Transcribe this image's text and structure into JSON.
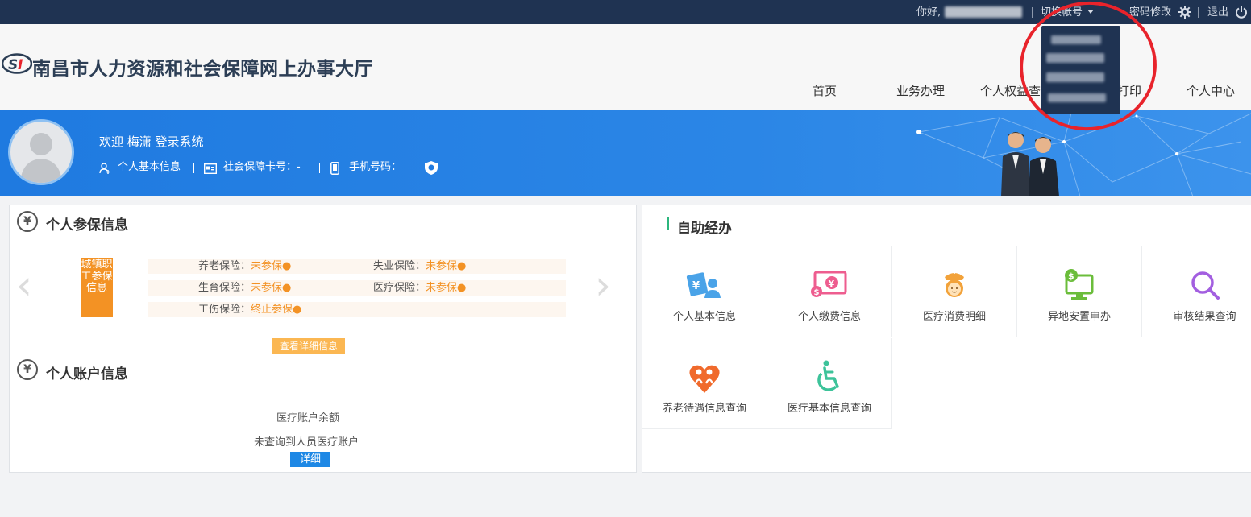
{
  "topbar": {
    "greeting": "你好,",
    "switch_account": "切换帐号",
    "change_password": "密码修改",
    "logout": "退出",
    "bg_color": "#1f3352"
  },
  "header": {
    "site_title": "南昌市人力资源和社会保障网上办事大厅",
    "nav": [
      "首页",
      "业务办理",
      "个人权益查",
      "打印",
      "个人中心"
    ]
  },
  "banner": {
    "welcome": "欢迎 梅潇 登录系统",
    "basic_info": "个人基本信息",
    "ss_card": "社会保障卡号：-",
    "phone": "手机号码：",
    "accent": "#1f7ae0"
  },
  "insurance": {
    "title": "个人参保信息",
    "tag": "城镇职工参保信息",
    "items": [
      {
        "label": "养老保险：",
        "status": "未参保●"
      },
      {
        "label": "失业保险：",
        "status": "未参保●"
      },
      {
        "label": "生育保险：",
        "status": "未参保●"
      },
      {
        "label": "医疗保险：",
        "status": "未参保●"
      },
      {
        "label": "工伤保险：",
        "status": "终止参保●"
      }
    ],
    "detail_button": "查看详细信息",
    "status_color": "#f39224"
  },
  "account": {
    "title": "个人账户信息",
    "balance_label": "医疗账户余额",
    "not_found": "未查询到人员医疗账户",
    "detail_button": "详细"
  },
  "self_service": {
    "title": "自助经办",
    "items": [
      {
        "label": "个人基本信息",
        "icon": "id-card-icon"
      },
      {
        "label": "个人缴费信息",
        "icon": "payment-icon"
      },
      {
        "label": "医疗消费明细",
        "icon": "nurse-icon"
      },
      {
        "label": "异地安置申办",
        "icon": "monitor-money-icon"
      },
      {
        "label": "审核结果查询",
        "icon": "magnifier-icon"
      },
      {
        "label": "养老待遇信息查询",
        "icon": "heart-people-icon"
      },
      {
        "label": "医疗基本信息查询",
        "icon": "wheelchair-icon"
      }
    ]
  }
}
